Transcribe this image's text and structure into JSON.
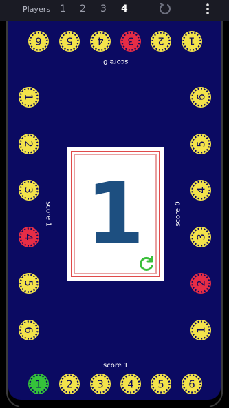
{
  "topbar": {
    "players_label": "Players",
    "player_counts": [
      "1",
      "2",
      "3",
      "4"
    ],
    "selected_player_count": "4"
  },
  "colors": {
    "board": "#0b0a62",
    "chip_normal": "#f3e34b",
    "chip_selected": "#e62d46",
    "chip_current": "#35c23a",
    "card_number": "#1d4f80",
    "refresh": "#3bbf3a"
  },
  "seats": {
    "top": {
      "score_label": "score 0",
      "chips": [
        "1",
        "2",
        "3",
        "4",
        "5",
        "6"
      ],
      "selected": "3"
    },
    "left": {
      "score_label": "score 1",
      "chips": [
        "1",
        "2",
        "3",
        "4",
        "5",
        "6"
      ],
      "selected": "4"
    },
    "right": {
      "score_label": "score 0",
      "chips": [
        "1",
        "2",
        "3",
        "4",
        "5",
        "6"
      ],
      "selected": "2"
    },
    "bottom": {
      "score_label": "score 1",
      "chips": [
        "1",
        "2",
        "3",
        "4",
        "5",
        "6"
      ],
      "selected": "1"
    }
  },
  "card": {
    "value": "1"
  }
}
